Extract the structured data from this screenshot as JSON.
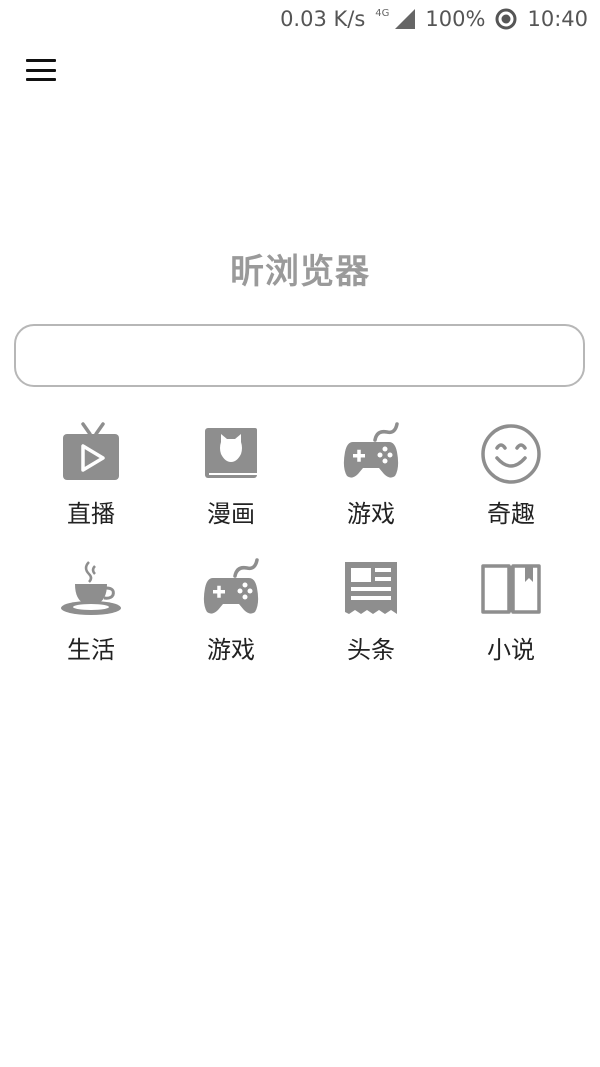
{
  "status_bar": {
    "net_speed": "0.03 K/s",
    "net_type": "4G",
    "battery": "100%",
    "time": "10:40"
  },
  "app": {
    "title": "昕浏览器"
  },
  "search": {
    "value": "",
    "placeholder": ""
  },
  "categories": [
    {
      "label": "直播",
      "icon": "tv-play-icon"
    },
    {
      "label": "漫画",
      "icon": "cat-book-icon"
    },
    {
      "label": "游戏",
      "icon": "gamepad-icon"
    },
    {
      "label": "奇趣",
      "icon": "smiley-icon"
    },
    {
      "label": "生活",
      "icon": "coffee-cup-icon"
    },
    {
      "label": "游戏",
      "icon": "gamepad-icon"
    },
    {
      "label": "头条",
      "icon": "newspaper-icon"
    },
    {
      "label": "小说",
      "icon": "open-book-icon"
    }
  ],
  "colors": {
    "icon": "#8e8e8e",
    "title": "#9a9a9a",
    "label": "#222222",
    "search_border": "#b7b7b7"
  }
}
